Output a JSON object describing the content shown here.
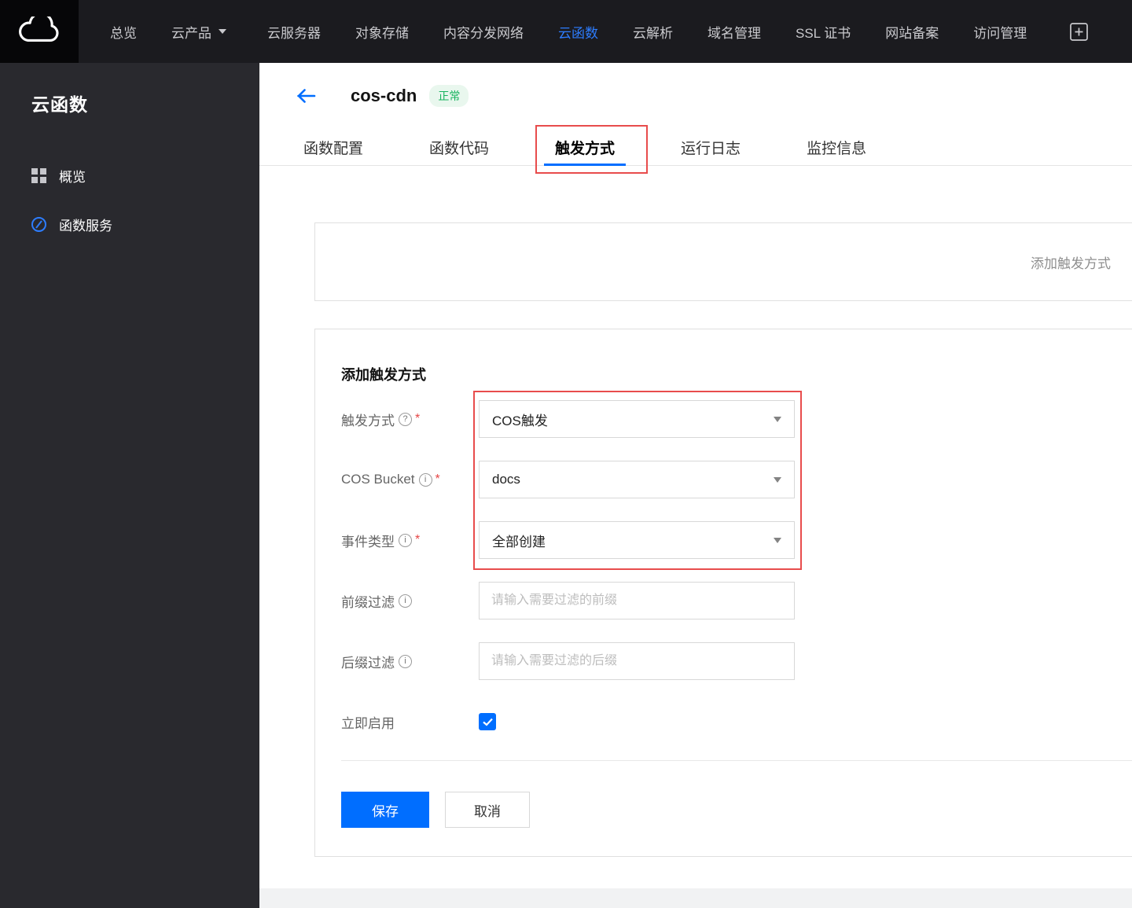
{
  "topnav": {
    "menu": [
      {
        "label": "总览"
      },
      {
        "label": "云产品"
      }
    ],
    "products": [
      "云服务器",
      "对象存储",
      "内容分发网络",
      "云函数",
      "云解析",
      "域名管理",
      "SSL 证书",
      "网站备案",
      "访问管理"
    ],
    "active_product": "云函数"
  },
  "sidebar": {
    "title": "云函数",
    "items": [
      {
        "label": "概览",
        "icon": "overview-grid-icon"
      },
      {
        "label": "函数服务",
        "icon": "function-service-icon"
      }
    ]
  },
  "header": {
    "title": "cos-cdn",
    "status": "正常"
  },
  "tabs": [
    {
      "label": "函数配置",
      "active": false
    },
    {
      "label": "函数代码",
      "active": false
    },
    {
      "label": "触发方式",
      "active": true,
      "annotated": true
    },
    {
      "label": "运行日志",
      "active": false
    },
    {
      "label": "监控信息",
      "active": false
    }
  ],
  "trigger_bar": {
    "add_label": "添加触发方式"
  },
  "form": {
    "heading": "添加触发方式",
    "required_mark": "*",
    "fields": {
      "trigger_type": {
        "label": "触发方式",
        "value": "COS触发",
        "required": true,
        "help_icon": "question"
      },
      "cos_bucket": {
        "label": "COS Bucket",
        "value": "docs",
        "required": true,
        "help_icon": "info"
      },
      "event_type": {
        "label": "事件类型",
        "value": "全部创建",
        "required": true,
        "help_icon": "info"
      },
      "prefix_filter": {
        "label": "前缀过滤",
        "placeholder": "请输入需要过滤的前缀",
        "help_icon": "info"
      },
      "suffix_filter": {
        "label": "后缀过滤",
        "placeholder": "请输入需要过滤的后缀",
        "help_icon": "info"
      },
      "enable_now": {
        "label": "立即启用",
        "checked": true
      }
    },
    "buttons": {
      "save": "保存",
      "cancel": "取消"
    }
  },
  "icons": {
    "question_glyph": "?",
    "info_glyph": "i"
  },
  "colors": {
    "accent": "#006eff",
    "status_green": "#0abf5b",
    "annotation_red": "#e84c4c"
  }
}
